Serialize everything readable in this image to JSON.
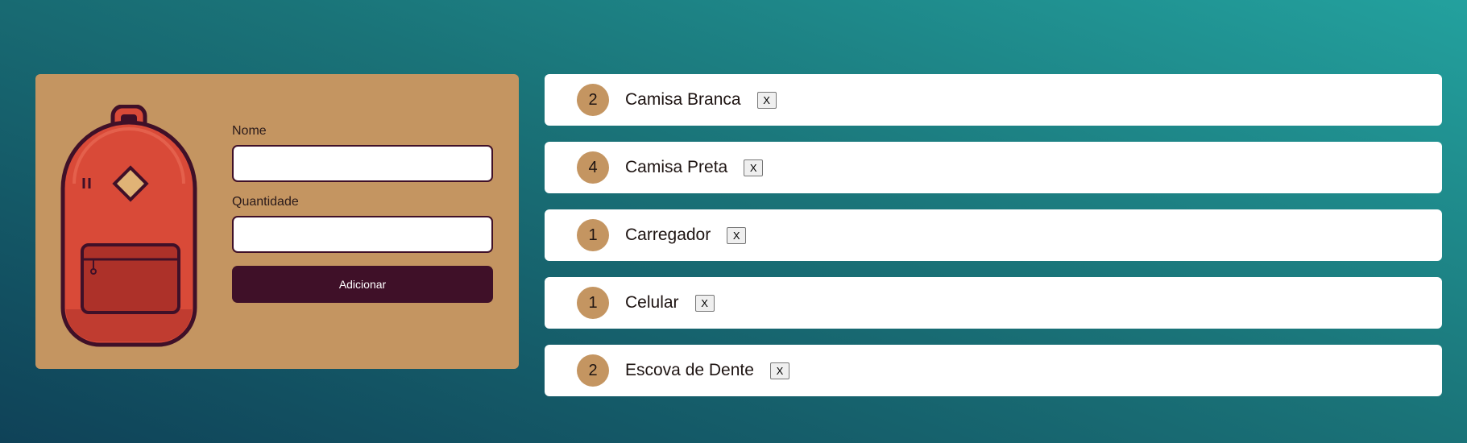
{
  "form": {
    "name_label": "Nome",
    "name_value": "",
    "quantity_label": "Quantidade",
    "quantity_value": "",
    "submit_label": "Adicionar"
  },
  "illustration": {
    "icon": "backpack-icon"
  },
  "items": [
    {
      "quantity": "2",
      "name": "Camisa Branca",
      "remove_label": "X"
    },
    {
      "quantity": "4",
      "name": "Camisa Preta",
      "remove_label": "X"
    },
    {
      "quantity": "1",
      "name": "Carregador",
      "remove_label": "X"
    },
    {
      "quantity": "1",
      "name": "Celular",
      "remove_label": "X"
    },
    {
      "quantity": "2",
      "name": "Escova de Dente",
      "remove_label": "X"
    }
  ],
  "colors": {
    "background_top": "#23a19e",
    "background_bottom": "#0f4258",
    "card": "#c49561",
    "accent_dark": "#3f1028",
    "backpack_red": "#d94a38",
    "pocket_red": "#ad3129",
    "badge": "#c49561"
  }
}
